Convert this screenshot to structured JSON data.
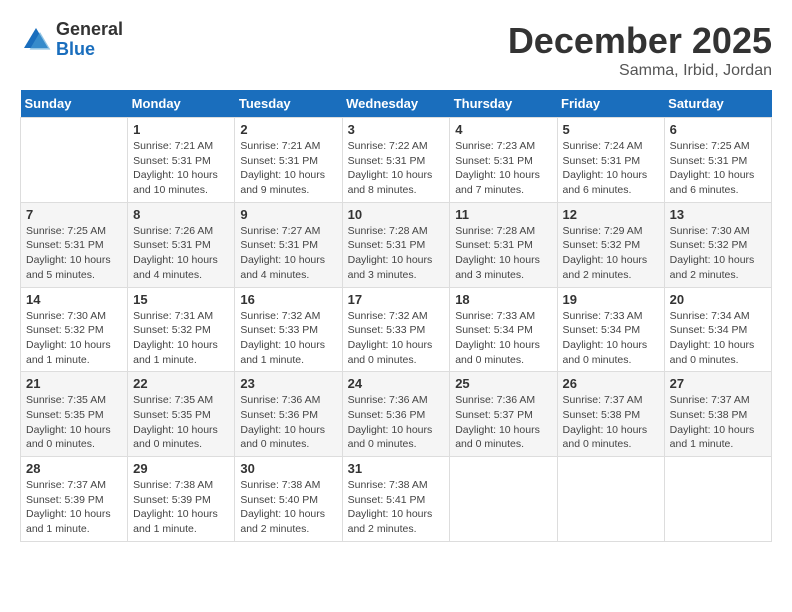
{
  "logo": {
    "general": "General",
    "blue": "Blue"
  },
  "title": {
    "month_year": "December 2025",
    "location": "Samma, Irbid, Jordan"
  },
  "days_of_week": [
    "Sunday",
    "Monday",
    "Tuesday",
    "Wednesday",
    "Thursday",
    "Friday",
    "Saturday"
  ],
  "weeks": [
    [
      {
        "day": "",
        "detail": ""
      },
      {
        "day": "1",
        "detail": "Sunrise: 7:21 AM\nSunset: 5:31 PM\nDaylight: 10 hours\nand 10 minutes."
      },
      {
        "day": "2",
        "detail": "Sunrise: 7:21 AM\nSunset: 5:31 PM\nDaylight: 10 hours\nand 9 minutes."
      },
      {
        "day": "3",
        "detail": "Sunrise: 7:22 AM\nSunset: 5:31 PM\nDaylight: 10 hours\nand 8 minutes."
      },
      {
        "day": "4",
        "detail": "Sunrise: 7:23 AM\nSunset: 5:31 PM\nDaylight: 10 hours\nand 7 minutes."
      },
      {
        "day": "5",
        "detail": "Sunrise: 7:24 AM\nSunset: 5:31 PM\nDaylight: 10 hours\nand 6 minutes."
      },
      {
        "day": "6",
        "detail": "Sunrise: 7:25 AM\nSunset: 5:31 PM\nDaylight: 10 hours\nand 6 minutes."
      }
    ],
    [
      {
        "day": "7",
        "detail": "Sunrise: 7:25 AM\nSunset: 5:31 PM\nDaylight: 10 hours\nand 5 minutes."
      },
      {
        "day": "8",
        "detail": "Sunrise: 7:26 AM\nSunset: 5:31 PM\nDaylight: 10 hours\nand 4 minutes."
      },
      {
        "day": "9",
        "detail": "Sunrise: 7:27 AM\nSunset: 5:31 PM\nDaylight: 10 hours\nand 4 minutes."
      },
      {
        "day": "10",
        "detail": "Sunrise: 7:28 AM\nSunset: 5:31 PM\nDaylight: 10 hours\nand 3 minutes."
      },
      {
        "day": "11",
        "detail": "Sunrise: 7:28 AM\nSunset: 5:31 PM\nDaylight: 10 hours\nand 3 minutes."
      },
      {
        "day": "12",
        "detail": "Sunrise: 7:29 AM\nSunset: 5:32 PM\nDaylight: 10 hours\nand 2 minutes."
      },
      {
        "day": "13",
        "detail": "Sunrise: 7:30 AM\nSunset: 5:32 PM\nDaylight: 10 hours\nand 2 minutes."
      }
    ],
    [
      {
        "day": "14",
        "detail": "Sunrise: 7:30 AM\nSunset: 5:32 PM\nDaylight: 10 hours\nand 1 minute."
      },
      {
        "day": "15",
        "detail": "Sunrise: 7:31 AM\nSunset: 5:32 PM\nDaylight: 10 hours\nand 1 minute."
      },
      {
        "day": "16",
        "detail": "Sunrise: 7:32 AM\nSunset: 5:33 PM\nDaylight: 10 hours\nand 1 minute."
      },
      {
        "day": "17",
        "detail": "Sunrise: 7:32 AM\nSunset: 5:33 PM\nDaylight: 10 hours\nand 0 minutes."
      },
      {
        "day": "18",
        "detail": "Sunrise: 7:33 AM\nSunset: 5:34 PM\nDaylight: 10 hours\nand 0 minutes."
      },
      {
        "day": "19",
        "detail": "Sunrise: 7:33 AM\nSunset: 5:34 PM\nDaylight: 10 hours\nand 0 minutes."
      },
      {
        "day": "20",
        "detail": "Sunrise: 7:34 AM\nSunset: 5:34 PM\nDaylight: 10 hours\nand 0 minutes."
      }
    ],
    [
      {
        "day": "21",
        "detail": "Sunrise: 7:35 AM\nSunset: 5:35 PM\nDaylight: 10 hours\nand 0 minutes."
      },
      {
        "day": "22",
        "detail": "Sunrise: 7:35 AM\nSunset: 5:35 PM\nDaylight: 10 hours\nand 0 minutes."
      },
      {
        "day": "23",
        "detail": "Sunrise: 7:36 AM\nSunset: 5:36 PM\nDaylight: 10 hours\nand 0 minutes."
      },
      {
        "day": "24",
        "detail": "Sunrise: 7:36 AM\nSunset: 5:36 PM\nDaylight: 10 hours\nand 0 minutes."
      },
      {
        "day": "25",
        "detail": "Sunrise: 7:36 AM\nSunset: 5:37 PM\nDaylight: 10 hours\nand 0 minutes."
      },
      {
        "day": "26",
        "detail": "Sunrise: 7:37 AM\nSunset: 5:38 PM\nDaylight: 10 hours\nand 0 minutes."
      },
      {
        "day": "27",
        "detail": "Sunrise: 7:37 AM\nSunset: 5:38 PM\nDaylight: 10 hours\nand 1 minute."
      }
    ],
    [
      {
        "day": "28",
        "detail": "Sunrise: 7:37 AM\nSunset: 5:39 PM\nDaylight: 10 hours\nand 1 minute."
      },
      {
        "day": "29",
        "detail": "Sunrise: 7:38 AM\nSunset: 5:39 PM\nDaylight: 10 hours\nand 1 minute."
      },
      {
        "day": "30",
        "detail": "Sunrise: 7:38 AM\nSunset: 5:40 PM\nDaylight: 10 hours\nand 2 minutes."
      },
      {
        "day": "31",
        "detail": "Sunrise: 7:38 AM\nSunset: 5:41 PM\nDaylight: 10 hours\nand 2 minutes."
      },
      {
        "day": "",
        "detail": ""
      },
      {
        "day": "",
        "detail": ""
      },
      {
        "day": "",
        "detail": ""
      }
    ]
  ]
}
